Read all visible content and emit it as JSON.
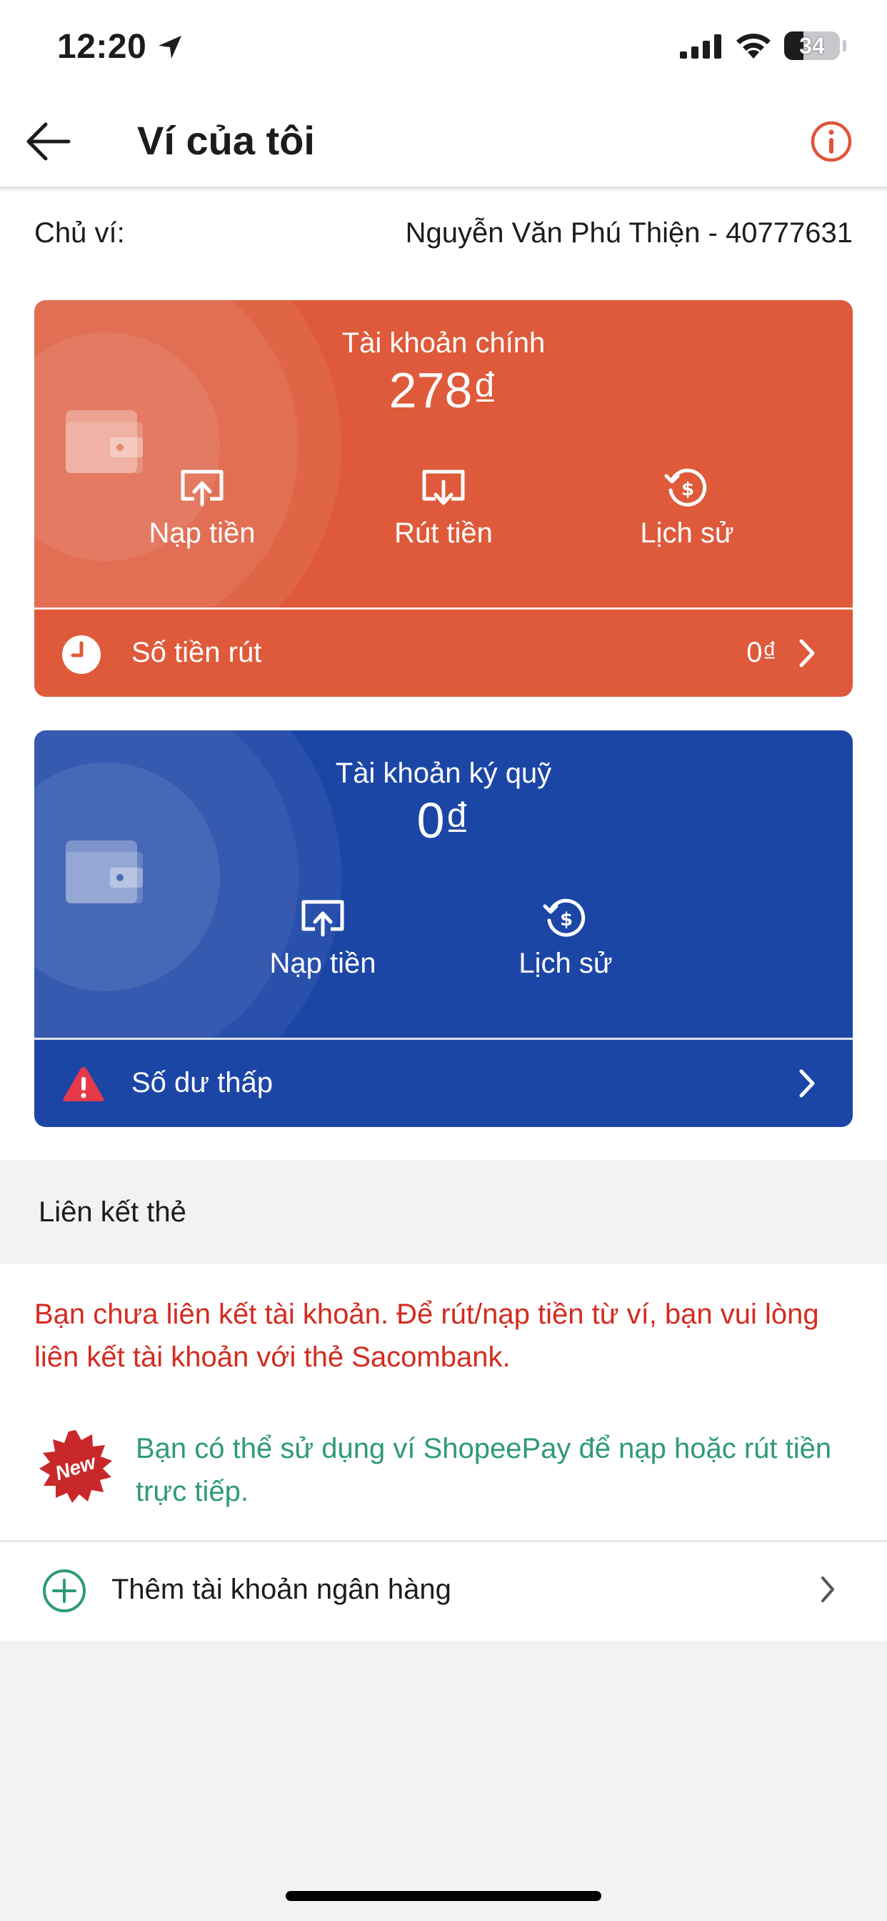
{
  "status_bar": {
    "time": "12:20",
    "battery": "34"
  },
  "header": {
    "title": "Ví của tôi"
  },
  "owner": {
    "label": "Chủ ví:",
    "value": "Nguyễn Văn Phú Thiện - 40777631"
  },
  "main_account": {
    "title": "Tài khoản chính",
    "balance": "278₫",
    "actions": [
      {
        "label": "Nạp tiền",
        "icon": "deposit-icon"
      },
      {
        "label": "Rút tiền",
        "icon": "withdraw-icon"
      },
      {
        "label": "Lịch sử",
        "icon": "history-icon"
      }
    ],
    "footer": {
      "label": "Số tiền rút",
      "value": "0₫",
      "icon": "clock-icon"
    },
    "color": "#de5a3a"
  },
  "deposit_account": {
    "title": "Tài khoản ký quỹ",
    "balance": "0₫",
    "actions": [
      {
        "label": "Nạp tiền",
        "icon": "deposit-icon"
      },
      {
        "label": "Lịch sử",
        "icon": "history-icon"
      }
    ],
    "footer": {
      "label": "Số dư thấp",
      "icon": "warning-icon"
    },
    "color": "#1c46a6"
  },
  "link_card": {
    "section_title": "Liên kết thẻ",
    "warning": "Bạn chưa liên kết tài khoản. Để rút/nạp tiền từ ví, bạn vui lòng liên kết tài khoản với thẻ Sacombank.",
    "badge": "New",
    "info": "Bạn có thể sử dụng ví ShopeePay để nạp hoặc rút tiền trực tiếp.",
    "add_bank": "Thêm tài khoản ngân hàng"
  }
}
